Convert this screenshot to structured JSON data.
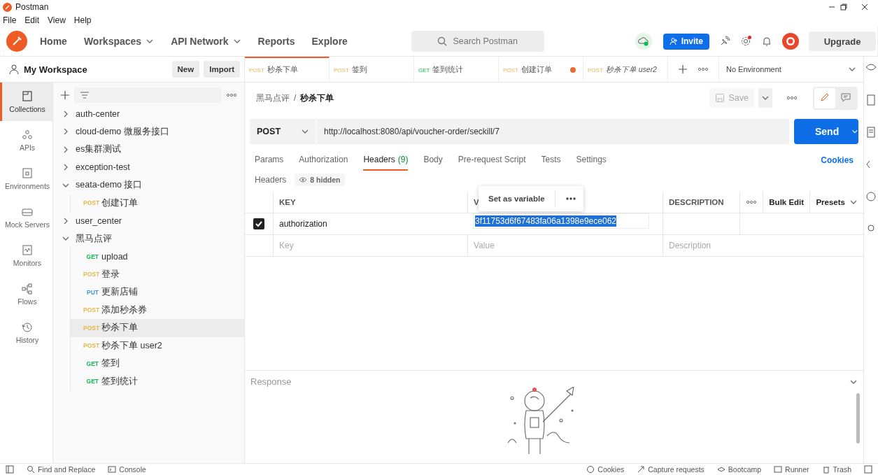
{
  "window": {
    "title": "Postman"
  },
  "menu": [
    "File",
    "Edit",
    "View",
    "Help"
  ],
  "nav": [
    {
      "label": "Home",
      "dropdown": false
    },
    {
      "label": "Workspaces",
      "dropdown": true
    },
    {
      "label": "API Network",
      "dropdown": true
    },
    {
      "label": "Reports",
      "dropdown": false
    },
    {
      "label": "Explore",
      "dropdown": false
    }
  ],
  "search": {
    "placeholder": "Search Postman"
  },
  "invite": "Invite",
  "upgrade": "Upgrade",
  "workspace": {
    "name": "My Workspace",
    "buttons": [
      "New",
      "Import"
    ]
  },
  "rail": [
    {
      "kind": "collections",
      "label": "Collections",
      "selected": true
    },
    {
      "kind": "apis",
      "label": "APIs",
      "selected": false
    },
    {
      "kind": "environments",
      "label": "Environments",
      "selected": false
    },
    {
      "kind": "mock",
      "label": "Mock Servers",
      "selected": false
    },
    {
      "kind": "monitors",
      "label": "Monitors",
      "selected": false
    },
    {
      "kind": "flows",
      "label": "Flows",
      "selected": false
    },
    {
      "kind": "history",
      "label": "History",
      "selected": false
    }
  ],
  "collections": [
    {
      "name": "auth-center",
      "expanded": false
    },
    {
      "name": "cloud-demo 微服务接口",
      "expanded": false
    },
    {
      "name": "es集群测试",
      "expanded": false
    },
    {
      "name": "exception-test",
      "expanded": false
    },
    {
      "name": "seata-demo 接口",
      "expanded": true,
      "children": [
        {
          "method": "POST",
          "name": "创建订单",
          "selected": false
        }
      ]
    },
    {
      "name": "user_center",
      "expanded": false
    },
    {
      "name": "黑马点评",
      "expanded": true,
      "children": [
        {
          "method": "GET",
          "name": "upload",
          "selected": false
        },
        {
          "method": "POST",
          "name": "登录",
          "selected": false
        },
        {
          "method": "PUT",
          "name": "更新店铺",
          "selected": false
        },
        {
          "method": "POST",
          "name": "添加秒杀券",
          "selected": false
        },
        {
          "method": "POST",
          "name": "秒杀下单",
          "selected": true
        },
        {
          "method": "POST",
          "name": "秒杀下单 user2",
          "selected": false
        },
        {
          "method": "GET",
          "name": "签到",
          "selected": false
        },
        {
          "method": "GET",
          "name": "签到统计",
          "selected": false
        }
      ]
    }
  ],
  "tabs": [
    {
      "method": "POST",
      "name": "秒杀下单",
      "selected": true,
      "preview": false,
      "unsaved": false
    },
    {
      "method": "POST",
      "name": "签到",
      "selected": false,
      "preview": false,
      "unsaved": false
    },
    {
      "method": "GET",
      "name": "签到统计",
      "selected": false,
      "preview": false,
      "unsaved": false
    },
    {
      "method": "POST",
      "name": "创建订单",
      "selected": false,
      "preview": false,
      "unsaved": true
    },
    {
      "method": "POST",
      "name": "秒杀下单 user2",
      "selected": false,
      "preview": true,
      "unsaved": false
    }
  ],
  "environment": "No Environment",
  "breadcrumb": [
    "黑马点评",
    "秒杀下单"
  ],
  "breadcrumb_separator": "/",
  "save": "Save",
  "request": {
    "method": "POST",
    "url": "http://localhost:8080/api/voucher-order/seckill/7",
    "send": "Send"
  },
  "request_tabs": [
    {
      "label": "Params",
      "selected": false
    },
    {
      "label": "Authorization",
      "selected": false
    },
    {
      "label": "Headers",
      "count": "(9)",
      "selected": true
    },
    {
      "label": "Body",
      "selected": false
    },
    {
      "label": "Pre-request Script",
      "selected": false
    },
    {
      "label": "Tests",
      "selected": false
    },
    {
      "label": "Settings",
      "selected": false
    }
  ],
  "cookies": "Cookies",
  "headers_bar": {
    "label": "Headers",
    "hidden": "8 hidden"
  },
  "table": {
    "columns": [
      "KEY",
      "V",
      "DESCRIPTION"
    ],
    "bulk_edit": "Bulk Edit",
    "presets": "Presets",
    "rows": [
      {
        "checked": true,
        "key": "authorization",
        "value": "3f11753d6f67483fa06a1398e9ece062",
        "value_selected": true
      }
    ],
    "new_row": {
      "key": "Key",
      "value": "Value",
      "description": "Description"
    }
  },
  "popover": {
    "label": "Set as variable"
  },
  "response": {
    "title": "Response"
  },
  "status_bar": {
    "left": [
      "Find and Replace",
      "Console"
    ],
    "right": [
      "Cookies",
      "Capture requests",
      "Bootcamp",
      "Runner",
      "Trash"
    ]
  }
}
